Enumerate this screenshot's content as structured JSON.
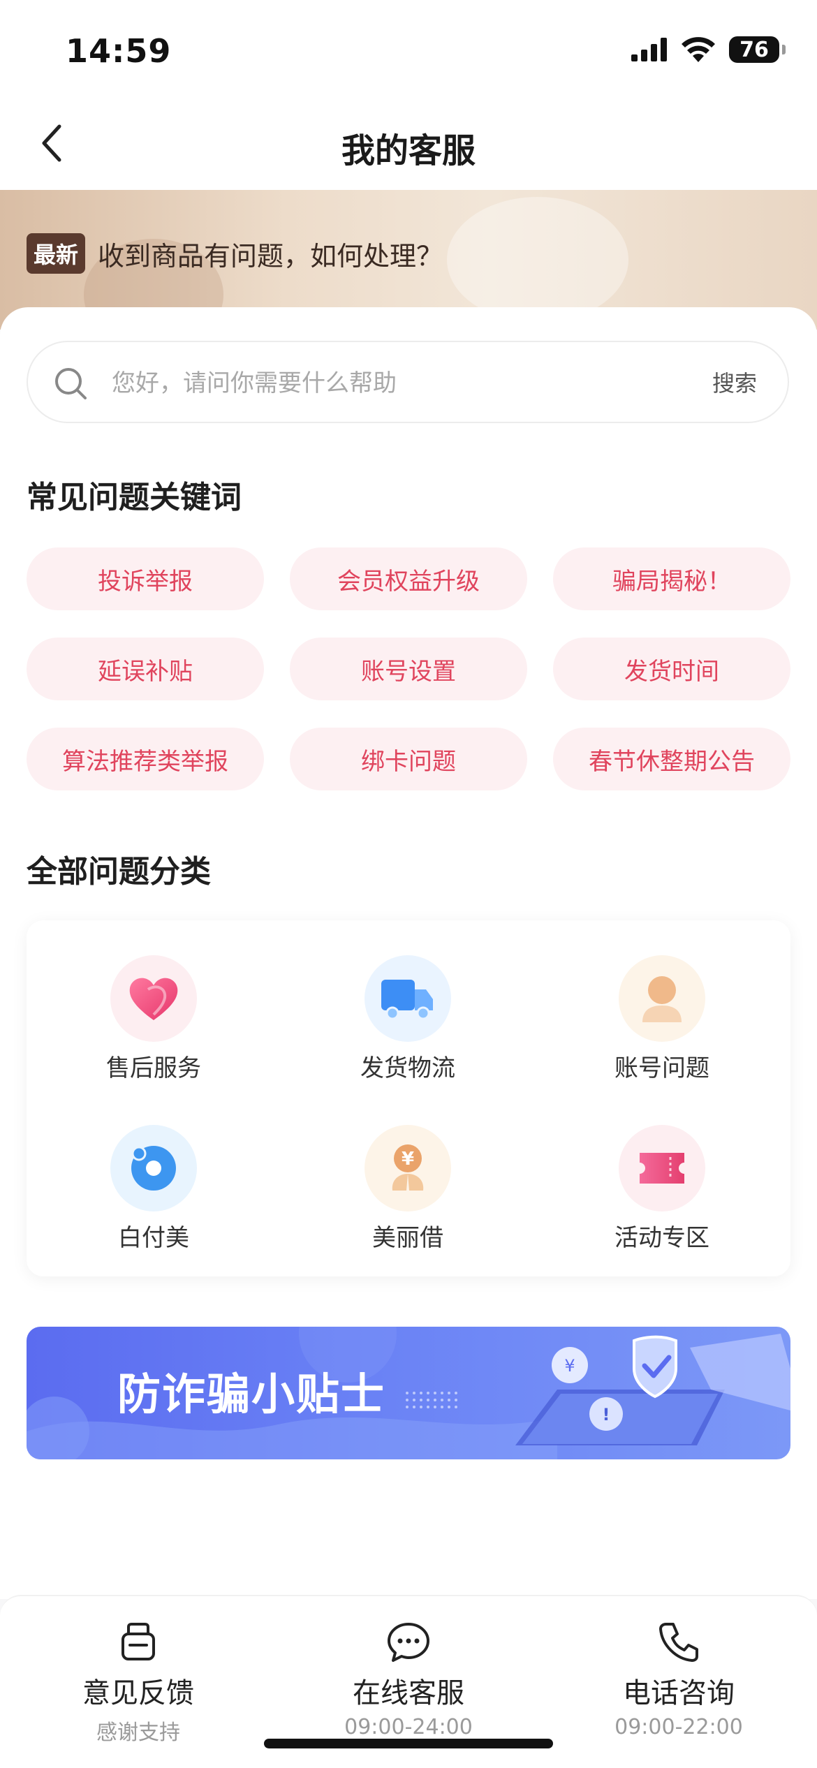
{
  "status_bar": {
    "time": "14:59",
    "battery": "76"
  },
  "nav": {
    "title": "我的客服"
  },
  "news": {
    "badge": "最新",
    "text": "收到商品有问题，如何处理？"
  },
  "search": {
    "placeholder": "您好，请问你需要什么帮助",
    "button": "搜索"
  },
  "keywords": {
    "title": "常见问题关键词",
    "items": [
      "投诉举报",
      "会员权益升级",
      "骗局揭秘！",
      "延误补贴",
      "账号设置",
      "发货时间",
      "算法推荐类举报",
      "绑卡问题",
      "春节休整期公告"
    ]
  },
  "categories": {
    "title": "全部问题分类",
    "items": [
      {
        "label": "售后服务",
        "icon": "heart-icon",
        "bg": "#fdeef1"
      },
      {
        "label": "发货物流",
        "icon": "truck-icon",
        "bg": "#eaf4ff"
      },
      {
        "label": "账号问题",
        "icon": "user-icon",
        "bg": "#fdf4e8"
      },
      {
        "label": "白付美",
        "icon": "wallet-icon",
        "bg": "#e8f4fe"
      },
      {
        "label": "美丽借",
        "icon": "money-bag-icon",
        "bg": "#fdf4e8"
      },
      {
        "label": "活动专区",
        "icon": "ticket-icon",
        "bg": "#fdeef1"
      }
    ]
  },
  "tips_banner": {
    "title": "防诈骗小贴士"
  },
  "bottom_bar": {
    "items": [
      {
        "label": "意见反馈",
        "sub": "感谢支持",
        "icon": "feedback-icon"
      },
      {
        "label": "在线客服",
        "sub": "09:00-24:00",
        "icon": "chat-icon"
      },
      {
        "label": "电话咨询",
        "sub": "09:00-22:00",
        "icon": "phone-icon"
      }
    ]
  },
  "colors": {
    "accent": "#e0445d",
    "chip_bg": "#fdf0f2",
    "banner_blue": "#5b6cf0"
  }
}
